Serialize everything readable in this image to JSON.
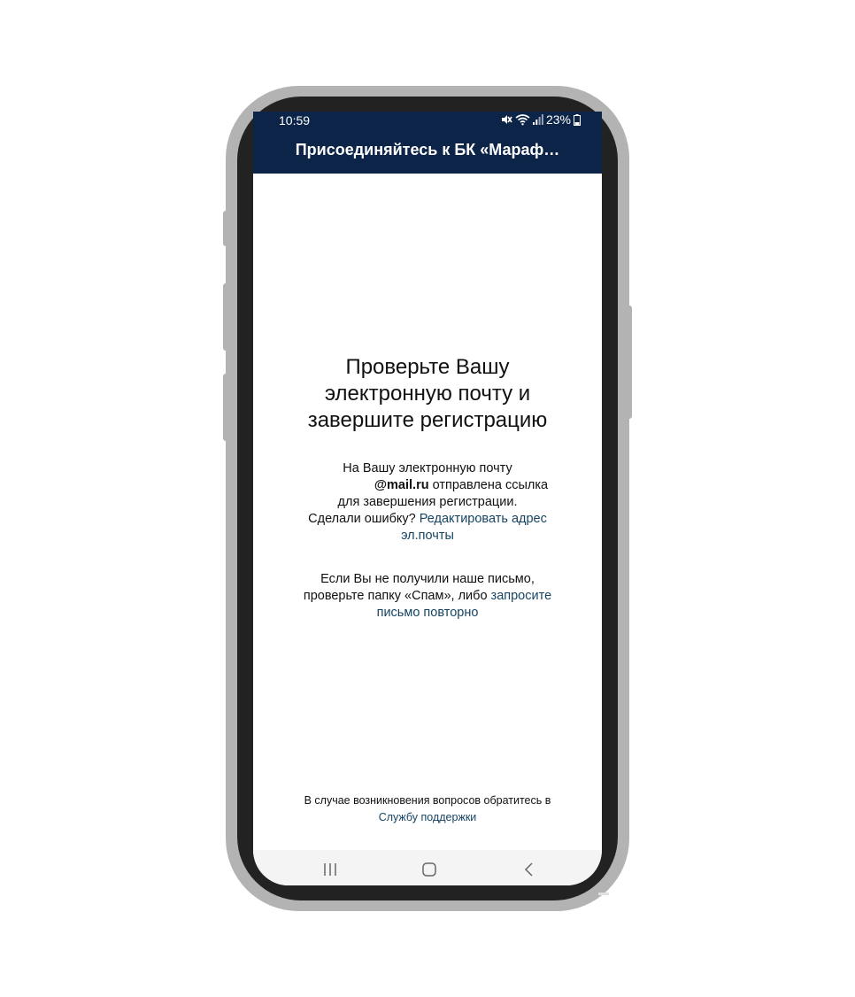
{
  "status_bar": {
    "time": "10:59",
    "battery": "23%"
  },
  "header": {
    "title": "Присоединяйтесь к БК «Мараф…"
  },
  "main": {
    "heading_line1": "Проверьте Вашу",
    "heading_line2": "электронную почту и",
    "heading_line3": "завершите регистрацию",
    "para1_text_a": "На Вашу электронную почту",
    "para1_email": "@mail.ru",
    "para1_text_b": " отправлена ссылка",
    "para1_text_c": "для завершения регистрации.",
    "para1_text_d": "Сделали ошибку? ",
    "para1_link": "Редактировать адрес эл.почты",
    "para2_text_a": "Если Вы не получили наше письмо, проверьте папку «Спам», либо ",
    "para2_link": "запросите письмо повторно"
  },
  "footer": {
    "note": "В случае возникновения вопросов обратитесь в",
    "support_link": "Службу поддержки"
  },
  "nav": {
    "recents": "recents-icon",
    "home": "home-icon",
    "back": "back-icon"
  },
  "colors": {
    "header_bg": "#0b2447",
    "link": "#164463"
  }
}
